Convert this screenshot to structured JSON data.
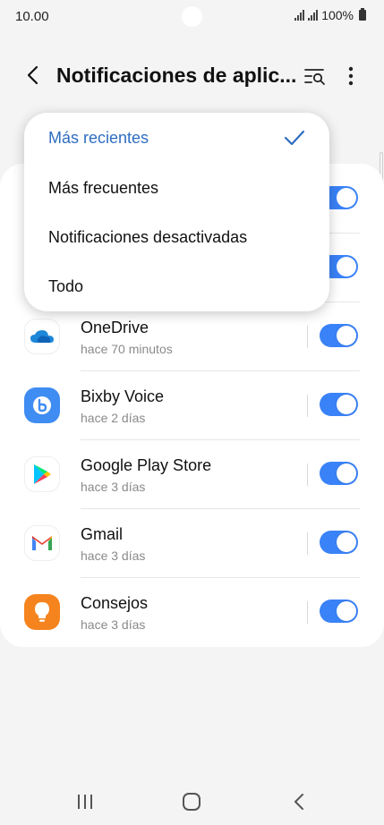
{
  "status_bar": {
    "time": "10.00",
    "battery": "100%",
    "icons": [
      "signal-icon",
      "signal-icon",
      "battery-icon"
    ]
  },
  "header": {
    "title": "Notificaciones de aplic...",
    "back_icon": "back-arrow-icon",
    "sort_icon": "sort-filter-icon",
    "more_icon": "more-options-icon"
  },
  "sort_menu": {
    "items": [
      {
        "label": "Más recientes",
        "selected": true
      },
      {
        "label": "Más frecuentes",
        "selected": false
      },
      {
        "label": "Notificaciones desactivadas",
        "selected": false
      },
      {
        "label": "Todo",
        "selected": false
      }
    ],
    "check_icon": "checkmark-icon"
  },
  "apps": [
    {
      "name": "OneDrive",
      "time": "hace 70 minutos",
      "icon": "onedrive-icon",
      "enabled": true
    },
    {
      "name": "Bixby Voice",
      "time": "hace 2 días",
      "icon": "bixby-voice-icon",
      "enabled": true
    },
    {
      "name": "Google Play Store",
      "time": "hace 3 días",
      "icon": "google-play-icon",
      "enabled": true
    },
    {
      "name": "Gmail",
      "time": "hace 3 días",
      "icon": "gmail-icon",
      "enabled": true
    },
    {
      "name": "Consejos",
      "time": "hace 3 días",
      "icon": "tips-bulb-icon",
      "enabled": true
    }
  ],
  "nav_bar": {
    "icons": [
      "recent-apps-icon",
      "home-icon",
      "back-icon"
    ]
  },
  "colors": {
    "accent": "#3a82f7",
    "selected_text": "#2f6dc1",
    "background": "#f4f4f4"
  }
}
